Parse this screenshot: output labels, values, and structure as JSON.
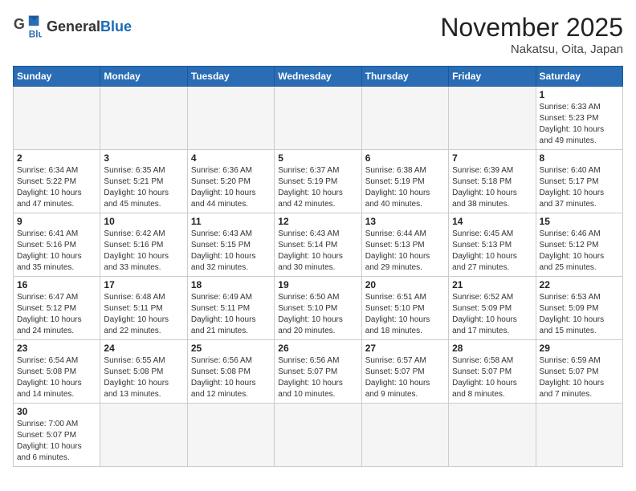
{
  "header": {
    "logo_general": "General",
    "logo_blue": "Blue",
    "month_title": "November 2025",
    "location": "Nakatsu, Oita, Japan"
  },
  "weekdays": [
    "Sunday",
    "Monday",
    "Tuesday",
    "Wednesday",
    "Thursday",
    "Friday",
    "Saturday"
  ],
  "weeks": [
    [
      {
        "day": "",
        "info": ""
      },
      {
        "day": "",
        "info": ""
      },
      {
        "day": "",
        "info": ""
      },
      {
        "day": "",
        "info": ""
      },
      {
        "day": "",
        "info": ""
      },
      {
        "day": "",
        "info": ""
      },
      {
        "day": "1",
        "info": "Sunrise: 6:33 AM\nSunset: 5:23 PM\nDaylight: 10 hours\nand 49 minutes."
      }
    ],
    [
      {
        "day": "2",
        "info": "Sunrise: 6:34 AM\nSunset: 5:22 PM\nDaylight: 10 hours\nand 47 minutes."
      },
      {
        "day": "3",
        "info": "Sunrise: 6:35 AM\nSunset: 5:21 PM\nDaylight: 10 hours\nand 45 minutes."
      },
      {
        "day": "4",
        "info": "Sunrise: 6:36 AM\nSunset: 5:20 PM\nDaylight: 10 hours\nand 44 minutes."
      },
      {
        "day": "5",
        "info": "Sunrise: 6:37 AM\nSunset: 5:19 PM\nDaylight: 10 hours\nand 42 minutes."
      },
      {
        "day": "6",
        "info": "Sunrise: 6:38 AM\nSunset: 5:19 PM\nDaylight: 10 hours\nand 40 minutes."
      },
      {
        "day": "7",
        "info": "Sunrise: 6:39 AM\nSunset: 5:18 PM\nDaylight: 10 hours\nand 38 minutes."
      },
      {
        "day": "8",
        "info": "Sunrise: 6:40 AM\nSunset: 5:17 PM\nDaylight: 10 hours\nand 37 minutes."
      }
    ],
    [
      {
        "day": "9",
        "info": "Sunrise: 6:41 AM\nSunset: 5:16 PM\nDaylight: 10 hours\nand 35 minutes."
      },
      {
        "day": "10",
        "info": "Sunrise: 6:42 AM\nSunset: 5:16 PM\nDaylight: 10 hours\nand 33 minutes."
      },
      {
        "day": "11",
        "info": "Sunrise: 6:43 AM\nSunset: 5:15 PM\nDaylight: 10 hours\nand 32 minutes."
      },
      {
        "day": "12",
        "info": "Sunrise: 6:43 AM\nSunset: 5:14 PM\nDaylight: 10 hours\nand 30 minutes."
      },
      {
        "day": "13",
        "info": "Sunrise: 6:44 AM\nSunset: 5:13 PM\nDaylight: 10 hours\nand 29 minutes."
      },
      {
        "day": "14",
        "info": "Sunrise: 6:45 AM\nSunset: 5:13 PM\nDaylight: 10 hours\nand 27 minutes."
      },
      {
        "day": "15",
        "info": "Sunrise: 6:46 AM\nSunset: 5:12 PM\nDaylight: 10 hours\nand 25 minutes."
      }
    ],
    [
      {
        "day": "16",
        "info": "Sunrise: 6:47 AM\nSunset: 5:12 PM\nDaylight: 10 hours\nand 24 minutes."
      },
      {
        "day": "17",
        "info": "Sunrise: 6:48 AM\nSunset: 5:11 PM\nDaylight: 10 hours\nand 22 minutes."
      },
      {
        "day": "18",
        "info": "Sunrise: 6:49 AM\nSunset: 5:11 PM\nDaylight: 10 hours\nand 21 minutes."
      },
      {
        "day": "19",
        "info": "Sunrise: 6:50 AM\nSunset: 5:10 PM\nDaylight: 10 hours\nand 20 minutes."
      },
      {
        "day": "20",
        "info": "Sunrise: 6:51 AM\nSunset: 5:10 PM\nDaylight: 10 hours\nand 18 minutes."
      },
      {
        "day": "21",
        "info": "Sunrise: 6:52 AM\nSunset: 5:09 PM\nDaylight: 10 hours\nand 17 minutes."
      },
      {
        "day": "22",
        "info": "Sunrise: 6:53 AM\nSunset: 5:09 PM\nDaylight: 10 hours\nand 15 minutes."
      }
    ],
    [
      {
        "day": "23",
        "info": "Sunrise: 6:54 AM\nSunset: 5:08 PM\nDaylight: 10 hours\nand 14 minutes."
      },
      {
        "day": "24",
        "info": "Sunrise: 6:55 AM\nSunset: 5:08 PM\nDaylight: 10 hours\nand 13 minutes."
      },
      {
        "day": "25",
        "info": "Sunrise: 6:56 AM\nSunset: 5:08 PM\nDaylight: 10 hours\nand 12 minutes."
      },
      {
        "day": "26",
        "info": "Sunrise: 6:56 AM\nSunset: 5:07 PM\nDaylight: 10 hours\nand 10 minutes."
      },
      {
        "day": "27",
        "info": "Sunrise: 6:57 AM\nSunset: 5:07 PM\nDaylight: 10 hours\nand 9 minutes."
      },
      {
        "day": "28",
        "info": "Sunrise: 6:58 AM\nSunset: 5:07 PM\nDaylight: 10 hours\nand 8 minutes."
      },
      {
        "day": "29",
        "info": "Sunrise: 6:59 AM\nSunset: 5:07 PM\nDaylight: 10 hours\nand 7 minutes."
      }
    ],
    [
      {
        "day": "30",
        "info": "Sunrise: 7:00 AM\nSunset: 5:07 PM\nDaylight: 10 hours\nand 6 minutes."
      },
      {
        "day": "",
        "info": ""
      },
      {
        "day": "",
        "info": ""
      },
      {
        "day": "",
        "info": ""
      },
      {
        "day": "",
        "info": ""
      },
      {
        "day": "",
        "info": ""
      },
      {
        "day": "",
        "info": ""
      }
    ]
  ]
}
